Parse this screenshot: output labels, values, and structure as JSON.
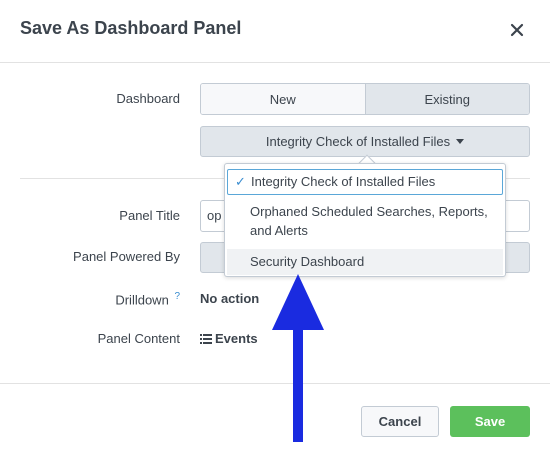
{
  "dialog": {
    "title": "Save As Dashboard Panel",
    "close_icon": "close-icon"
  },
  "form": {
    "dashboard_label": "Dashboard",
    "seg_new": "New",
    "seg_existing": "Existing",
    "selected_dashboard": "Integrity Check of Installed Files",
    "panel_title_label": "Panel Title",
    "panel_title_value": "op",
    "panel_powered_label": "Panel Powered By",
    "drilldown_label": "Drilldown",
    "drilldown_help": "?",
    "drilldown_value": "No action",
    "panel_content_label": "Panel Content",
    "panel_content_value": "Events"
  },
  "dropdown": {
    "items": [
      "Integrity Check of Installed Files",
      "Orphaned Scheduled Searches, Reports, and Alerts",
      "Security Dashboard"
    ],
    "selected_index": 0
  },
  "footer": {
    "cancel": "Cancel",
    "save": "Save"
  },
  "colors": {
    "save_green": "#5cc05c",
    "annotation_arrow": "#1a2be0",
    "check_blue": "#3a8dd0"
  }
}
